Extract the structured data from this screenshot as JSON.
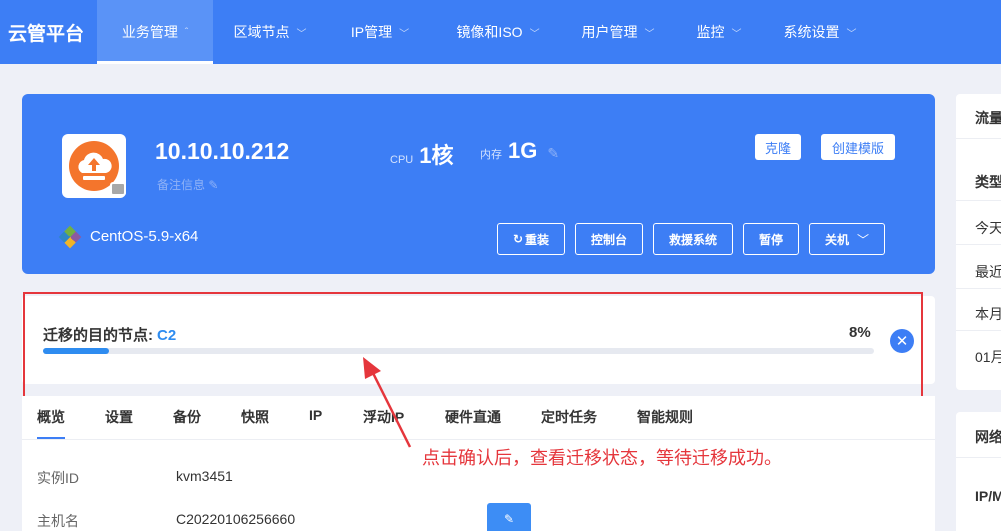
{
  "brand": "云管平台",
  "nav": [
    {
      "label": "业务管理",
      "active": true
    },
    {
      "label": "区域节点"
    },
    {
      "label": "IP管理"
    },
    {
      "label": "镜像和ISO"
    },
    {
      "label": "用户管理"
    },
    {
      "label": "监控"
    },
    {
      "label": "系统设置"
    }
  ],
  "instance": {
    "ip": "10.10.10.212",
    "remark_placeholder": "备注信息",
    "cpu_label": "CPU",
    "cpu_value": "1核",
    "mem_label": "内存",
    "mem_value": "1G",
    "clone_label": "克隆",
    "create_template_label": "创建模版",
    "os": "CentOS-5.9-x64",
    "actions": {
      "reinstall": "重装",
      "console": "控制台",
      "rescue": "救援系统",
      "pause": "暂停",
      "shutdown": "关机"
    }
  },
  "migration": {
    "label": "迁移的目的节点:",
    "node": "C2",
    "percent_text": "8%",
    "progress": 8
  },
  "tabs": [
    "概览",
    "设置",
    "备份",
    "快照",
    "IP",
    "浮动IP",
    "硬件直通",
    "定时任务",
    "智能规则"
  ],
  "details": [
    {
      "label": "实例ID",
      "value": "kvm3451"
    },
    {
      "label": "主机名",
      "value": "C20220106256660"
    }
  ],
  "annotation": "点击确认后，查看迁移状态，等待迁移成功。",
  "right_panel": {
    "card1": [
      "流量",
      "类型",
      "今天",
      "最近",
      "本月",
      "01月"
    ],
    "card2": [
      "网络",
      "IP/M"
    ]
  },
  "colors": {
    "primary": "#3d7ef5",
    "accent_blue": "#2e8cf0",
    "annotation_red": "#e5363c",
    "os_orange": "#f4752c"
  }
}
